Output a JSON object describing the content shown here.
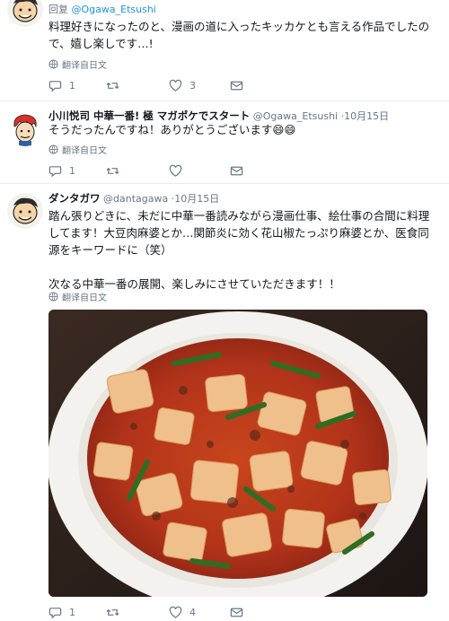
{
  "tweet1": {
    "reply_prefix": "回复",
    "reply_handle": "@Ogawa_Etsushi",
    "text": "料理好きになったのと、漫画の道に入ったキッカケとも言える作品でしたので、嬉し楽しです…!",
    "translate": "翻译自日文",
    "replies": "1",
    "retweets": "",
    "likes": "3"
  },
  "tweet2": {
    "name": "小川悦司 中華一番! 極 マガポケでスタート",
    "handle": "@Ogawa_Etsushi",
    "date": "·10月15日",
    "text": "そうだったんですね！ありがとうございます😄😄",
    "translate": "翻译自日文",
    "replies": "1",
    "retweets": "",
    "likes": ""
  },
  "tweet3": {
    "name": "ダンタガワ",
    "handle": "@dantagawa",
    "date": "·10月15日",
    "text": "踏ん張りどきに、未だに中華一番読みながら漫画仕事、絵仕事の合間に料理してます！大豆肉麻婆とか…関節炎に効く花山椒たっぷり麻婆とか、医食同源をキーワードに（笑）\n\n次なる中華一番の展開、楽しみにさせていただきます！！",
    "translate": "翻译自日文",
    "replies": "1",
    "retweets": "",
    "likes": "4"
  },
  "colors": {
    "link": "#1b95e0",
    "secondary": "#657786",
    "divider": "#e6ecf0"
  },
  "icons": [
    "reply-icon",
    "retweet-icon",
    "like-icon",
    "dm-icon",
    "globe-icon"
  ]
}
